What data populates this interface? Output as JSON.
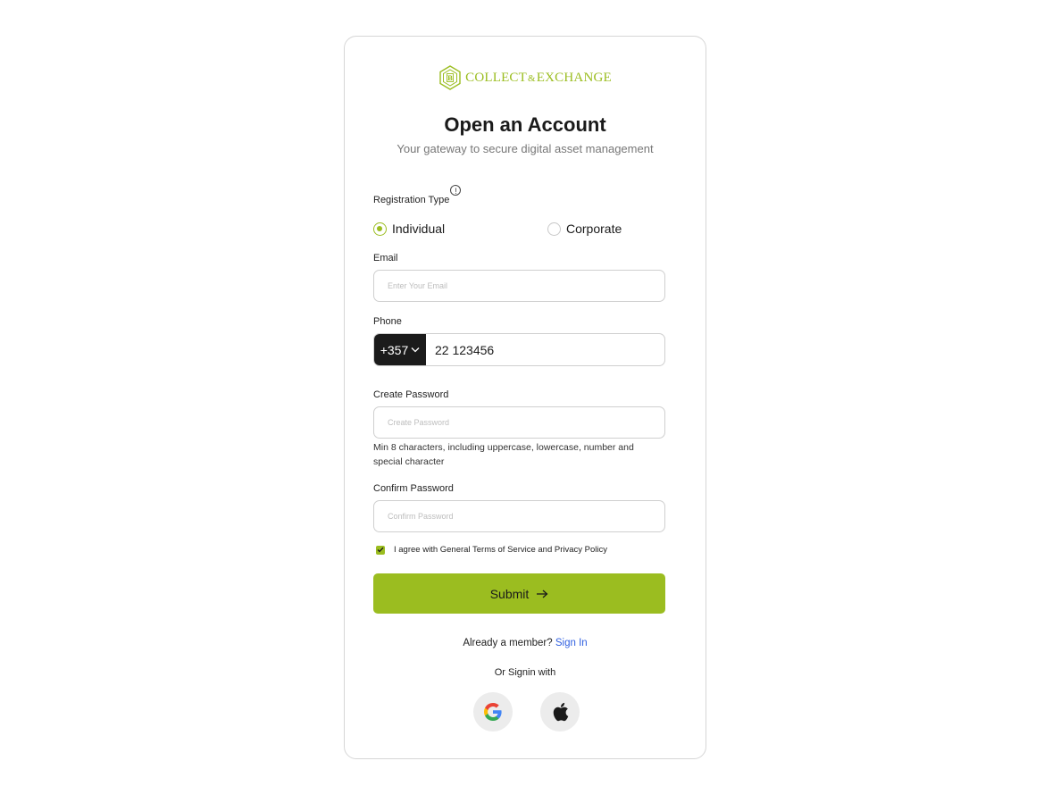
{
  "brand": {
    "name_left": "COLLECT",
    "amp": "&",
    "name_right": "EXCHANGE",
    "accent_color": "#9bbd20"
  },
  "header": {
    "title": "Open an Account",
    "subtitle": "Your gateway to secure digital asset management"
  },
  "registration": {
    "label": "Registration Type",
    "info_icon": "info-icon",
    "options": [
      {
        "label": "Individual",
        "selected": true
      },
      {
        "label": "Corporate",
        "selected": false
      }
    ]
  },
  "email": {
    "label": "Email",
    "placeholder": "Enter Your Email",
    "value": ""
  },
  "phone": {
    "label": "Phone",
    "country_code": "+357",
    "value": "22 123456"
  },
  "password": {
    "label": "Create Password",
    "placeholder": "Create Password",
    "hint": "Min 8 characters, including uppercase, lowercase, number and special character"
  },
  "confirm_password": {
    "label": "Confirm Password",
    "placeholder": "Confirm Password"
  },
  "terms": {
    "checked": true,
    "label": "I agree with General Terms of Service and Privacy Policy"
  },
  "submit": {
    "label": "Submit",
    "icon": "arrow-right-icon"
  },
  "footer": {
    "member_text": "Already a member?",
    "signin_link": "Sign In",
    "signin_with": "Or Signin with",
    "providers": [
      "google-icon",
      "apple-icon"
    ]
  }
}
